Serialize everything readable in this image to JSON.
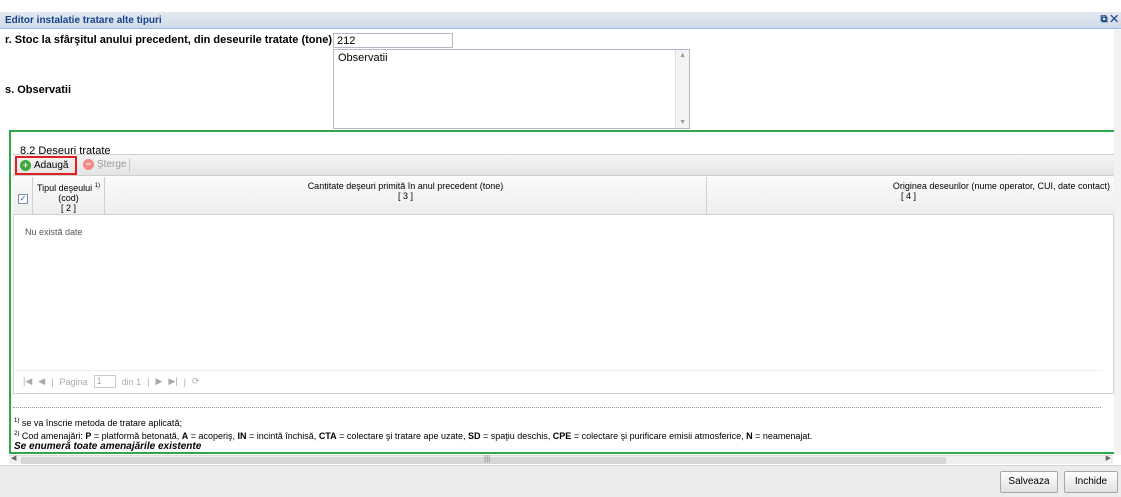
{
  "window": {
    "title": "Editor instalatie tratare alte tipuri",
    "restore_icon": "restore-icon",
    "close_icon": "close-icon"
  },
  "form": {
    "stock_label": "r. Stoc la sfârşitul anului precedent, din deseurile tratate (tone)",
    "stock_value": "212",
    "observations_label": "s. Observatii",
    "observations_value": "Observatii"
  },
  "section": {
    "title": "8.2 Deseuri tratate"
  },
  "toolbar": {
    "add_label": "Adaugă",
    "delete_label": "Şterge"
  },
  "grid": {
    "columns": [
      {
        "label": "Tipul deşeului",
        "sup": "1)",
        "sub": "(cod)",
        "index": "[ 2 ]"
      },
      {
        "label": "Cantitate deşeuri primită în anul precedent (tone)",
        "index": "[ 3 ]"
      },
      {
        "label": "Originea deseurilor (nume operator, CUI, date contact)",
        "index": "[ 4 ]"
      }
    ],
    "empty_text": "Nu există date"
  },
  "pager": {
    "page_label": "Pagina",
    "page_value": "1",
    "of_label": "din 1"
  },
  "notes": {
    "note1_sup": "1)",
    "note1": "se va înscrie metoda de tratare aplicată;",
    "note2_sup": "2)",
    "note2_prefix": "Cod amenajări: ",
    "note2_items": [
      {
        "code": "P",
        "text": " = platformă betonată, "
      },
      {
        "code": "A",
        "text": " = acoperiş, "
      },
      {
        "code": "IN",
        "text": " = incintă închisă, "
      },
      {
        "code": "CTA",
        "text": " = colectare şi tratare ape uzate, "
      },
      {
        "code": "SD",
        "text": " = spaţiu deschis, "
      },
      {
        "code": "CPE",
        "text": " = colectare şi purificare emisii atmosferice, "
      },
      {
        "code": "N",
        "text": " = neamenajat."
      }
    ],
    "note3": "Se enumeră toate amenajările existente"
  },
  "footer": {
    "save_label": "Salveaza",
    "close_label": "Inchide"
  }
}
